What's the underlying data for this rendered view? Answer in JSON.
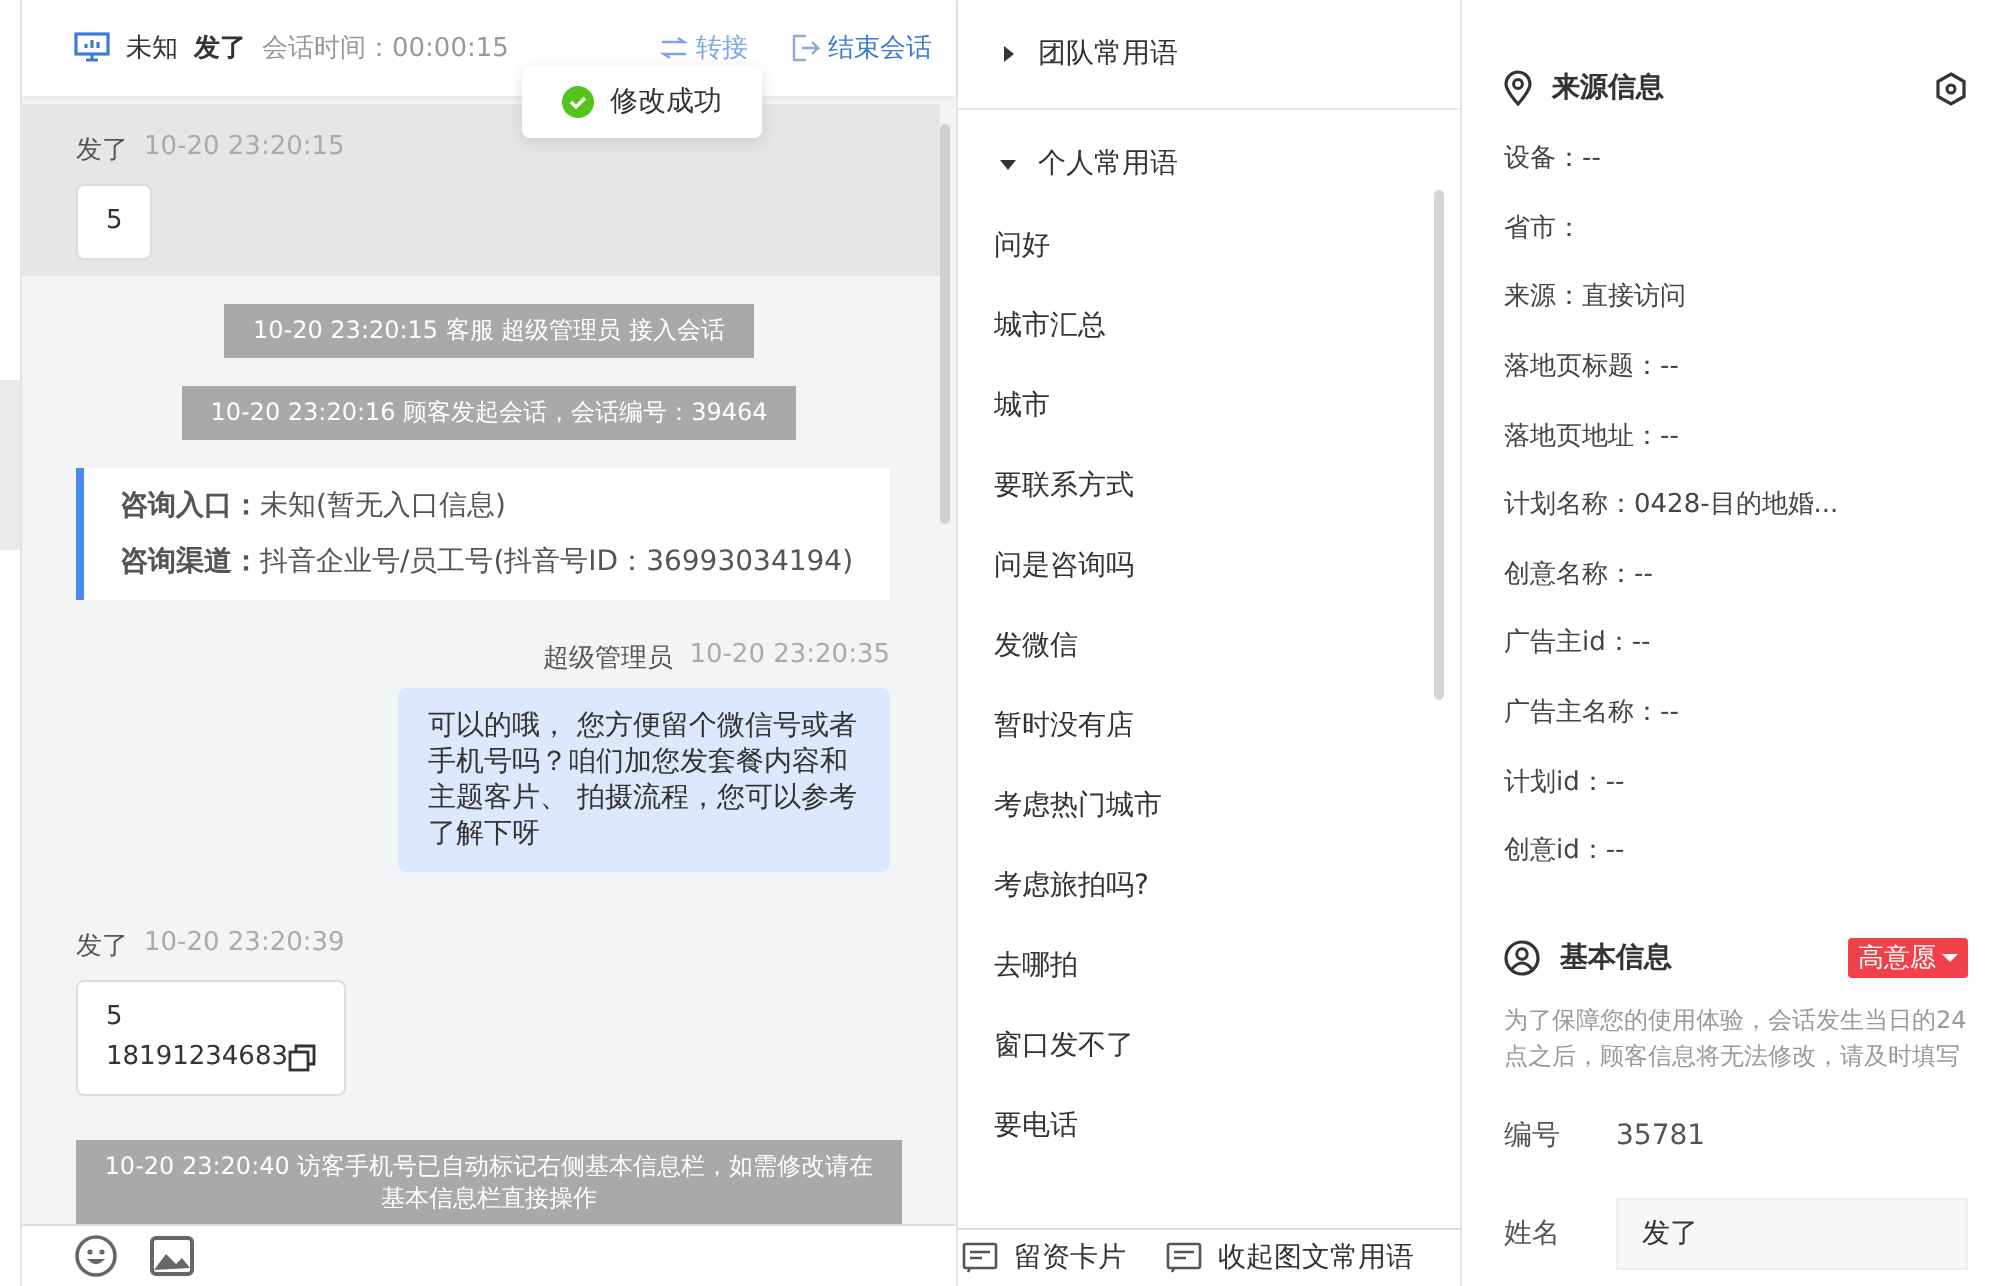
{
  "chat_header": {
    "visitor_status": "未知",
    "visitor_name": "发了",
    "session_time": "会话时间：00:00:15",
    "transfer": "转接",
    "end_session": "结束会话"
  },
  "toast": {
    "text": "修改成功"
  },
  "messages": [
    {
      "kind": "customer",
      "name": "发了",
      "time": "10-20 23:20:15",
      "lines": [
        "5"
      ],
      "highlighted": true,
      "copy_icon": false
    },
    {
      "kind": "system",
      "text": "10-20 23:20:15 客服 超级管理员 接入会话"
    },
    {
      "kind": "system",
      "text": "10-20 23:20:16 顾客发起会话，会话编号：39464"
    },
    {
      "kind": "entry_card",
      "lines": [
        "**咨询入口：**未知(暂无入口信息)",
        "**咨询渠道：**抖音企业号/员工号(抖音号ID：36993034194)"
      ]
    },
    {
      "kind": "agent",
      "name": "超级管理员",
      "time": "10-20 23:20:35",
      "text": "可以的哦， 您方便留个微信号或者手机号吗？咱们加您发套餐内容和主题客片、 拍摄流程，您可以参考了解下呀"
    },
    {
      "kind": "customer",
      "name": "发了",
      "time": "10-20 23:20:39",
      "lines": [
        "5",
        "18191234683"
      ],
      "highlighted": false,
      "copy_icon": true
    },
    {
      "kind": "system_wide",
      "text": "10-20 23:20:40 访客手机号已自动标记右侧基本信息栏，如需修改请在基本信息栏直接操作"
    }
  ],
  "phrases": {
    "groups": [
      {
        "title": "团队常用语",
        "expanded": false
      },
      {
        "title": "个人常用语",
        "expanded": true,
        "items": [
          "问好",
          "城市汇总",
          "城市",
          "要联系方式",
          "问是咨询吗",
          "发微信",
          "暂时没有店",
          "考虑热门城市",
          "考虑旅拍吗?",
          "去哪拍",
          "窗口发不了",
          "要电话"
        ]
      }
    ],
    "footer": [
      "留资卡片",
      "收起图文常用语"
    ]
  },
  "source_info": {
    "title": "来源信息",
    "rows": [
      "设备：--",
      "省市：",
      "来源：直接访问",
      "落地页标题：--",
      "落地页地址：--",
      "计划名称：0428-目的地婚...",
      "创意名称：--",
      "广告主id：--",
      "广告主名称：--",
      "计划id：--",
      "创意id：--"
    ]
  },
  "basic_info": {
    "title": "基本信息",
    "intent": "高意愿",
    "note": "为了保障您的使用体验，会话发生当日的24点之后，顾客信息将无法修改，请及时填写",
    "fields": [
      {
        "label": "编号",
        "value": "35781",
        "kind": "text"
      },
      {
        "label": "姓名",
        "value": "发了",
        "kind": "input"
      }
    ]
  }
}
